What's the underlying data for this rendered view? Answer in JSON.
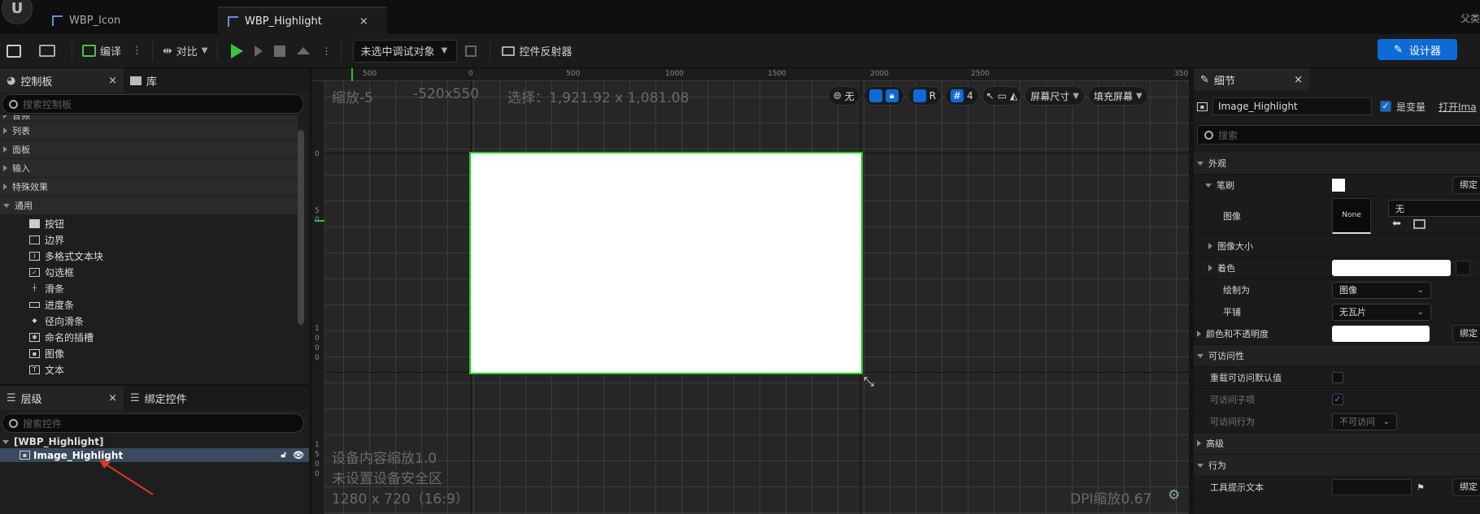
{
  "tabs": [
    {
      "label": "WBP_Icon",
      "active": false
    },
    {
      "label": "WBP_Highlight",
      "active": true
    }
  ],
  "tab_close": "×",
  "topright_label": "父类",
  "toolbar": {
    "compile": "编译",
    "diff": "对比",
    "debug_target": "未选中调试对象",
    "reflector": "控件反射器",
    "designer": "设计器"
  },
  "palette": {
    "tab": "控制板",
    "library_tab": "库",
    "search_placeholder": "搜索控制板",
    "categories": [
      "音频",
      "列表",
      "面板",
      "输入",
      "特殊效果",
      "通用"
    ],
    "widgets": [
      {
        "label": "按钮",
        "icon": "button-icon"
      },
      {
        "label": "边界",
        "icon": "border-icon"
      },
      {
        "label": "多格式文本块",
        "icon": "richtext-icon"
      },
      {
        "label": "勾选框",
        "icon": "checkbox-icon"
      },
      {
        "label": "滑条",
        "icon": "slider-icon"
      },
      {
        "label": "进度条",
        "icon": "progressbar-icon"
      },
      {
        "label": "径向滑条",
        "icon": "radial-slider-icon"
      },
      {
        "label": "命名的插槽",
        "icon": "named-slot-icon"
      },
      {
        "label": "图像",
        "icon": "image-icon"
      },
      {
        "label": "文本",
        "icon": "text-icon"
      }
    ]
  },
  "hierarchy": {
    "tab": "层级",
    "bind_tab": "绑定控件",
    "search_placeholder": "搜索控件",
    "root": "[WBP_Highlight]",
    "child": "Image_Highlight"
  },
  "canvas": {
    "zoom": "缩放-5",
    "coords": "-520x550",
    "selection": "选择：1,921.92 x 1,081.08",
    "ruler_h": [
      "500",
      "0",
      "500",
      "1000",
      "1500",
      "2000",
      "2500",
      "350"
    ],
    "ruler_v": [
      [
        "0"
      ],
      [
        "5",
        "0"
      ],
      [
        "1",
        "0",
        "0",
        "0"
      ],
      [
        "1",
        "5",
        "0",
        "0"
      ]
    ],
    "ctrl_none": "无",
    "ctrl_r": "R",
    "ctrl_grid": "4",
    "screen_size": "屏幕尺寸",
    "fill_screen": "填充屏幕",
    "device_scale": "设备内容缩放1.0",
    "safe_zone": "未设置设备安全区",
    "resolution": "1280 x 720（16:9）",
    "dpi": "DPI缩放0.67"
  },
  "details": {
    "tab": "细节",
    "name": "Image_Highlight",
    "is_variable": "是变量",
    "open": "打开Ima",
    "search_placeholder": "搜索",
    "sec_appearance": "外观",
    "brush": "笔刷",
    "bind": "绑定",
    "image": "图像",
    "none_thumb": "None",
    "none_value": "无",
    "image_size": "图像大小",
    "tint": "着色",
    "draw_as": "绘制为",
    "draw_as_value": "图像",
    "tiling": "平铺",
    "tiling_value": "无瓦片",
    "color_opacity": "颜色和不透明度",
    "sec_access": "可访问性",
    "override_access": "重载可访问默认值",
    "access_children": "可访问子项",
    "access_behavior": "可访问行为",
    "access_behavior_value": "不可访问",
    "sec_advanced": "高级",
    "sec_behavior": "行为",
    "tooltip": "工具提示文本"
  },
  "colors": {
    "accent": "#0e6ad6",
    "selection_green": "#1ed01e",
    "play_green": "#3ec23e"
  }
}
